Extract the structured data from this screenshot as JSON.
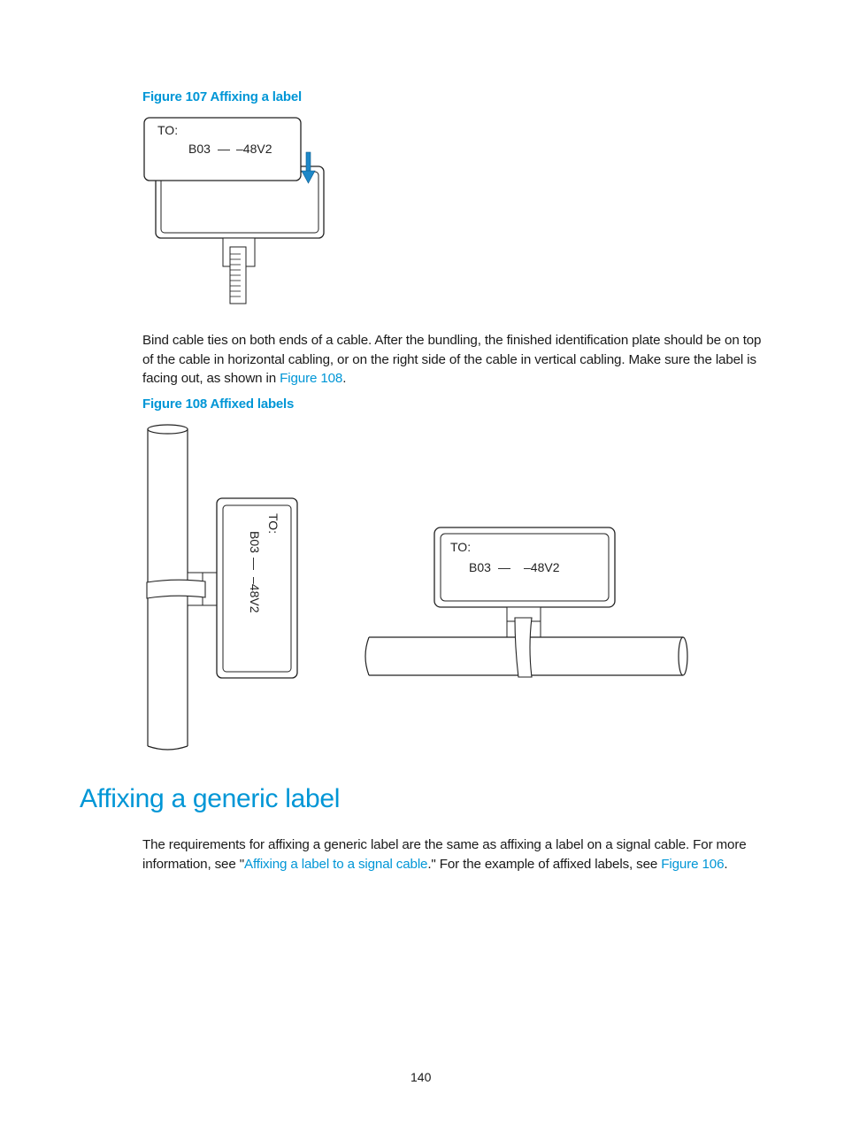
{
  "figure107": {
    "caption": "Figure 107 Affixing a label",
    "label_to": "TO:",
    "label_source": "B03",
    "label_dash": "—",
    "label_dest": "–48V2"
  },
  "body_paragraph": {
    "text_before_link": "Bind cable ties on both ends of a cable. After the bundling, the finished identification plate should be on top of the cable in horizontal cabling, or on the right side of the cable in vertical cabling. Make sure the label is facing out, as shown in ",
    "link": "Figure 108",
    "text_after_link": "."
  },
  "figure108": {
    "caption": "Figure 108 Affixed labels",
    "vertical_label": {
      "to": "TO:",
      "source": "B03",
      "dash": "—",
      "dest": "–48V2"
    },
    "horizontal_label": {
      "to": "TO:",
      "source": "B03",
      "dash": "—",
      "dest": "–48V2"
    }
  },
  "section": {
    "heading": "Affixing a generic label",
    "text_1": "The requirements for affixing a generic label are the same as affixing a label on a signal cable. For more information, see \"",
    "link_1": "Affixing a label to a signal cable",
    "text_2": ".\" For the example of affixed labels, see ",
    "link_2": "Figure 106",
    "text_3": "."
  },
  "footer": {
    "page_number": "140"
  },
  "colors": {
    "accent": "#0096d6",
    "text": "#1a1a1a"
  }
}
